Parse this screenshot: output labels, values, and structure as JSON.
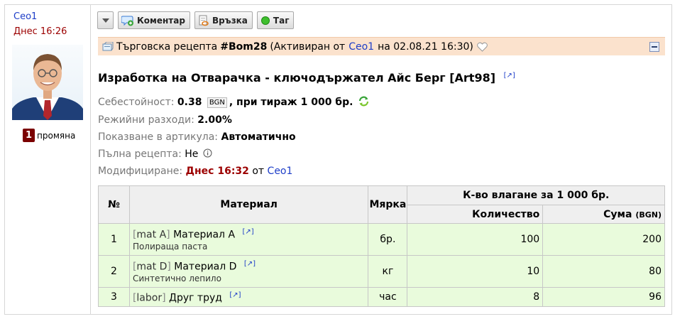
{
  "author": {
    "name": "Ceo1",
    "date": "Днес 16:26",
    "changes_count": "1",
    "changes_label": "промяна"
  },
  "toolbar": {
    "comment_label": "Коментар",
    "link_label": "Връзка",
    "tag_label": "Таг"
  },
  "banner": {
    "type_label": "Търговска рецепта",
    "number": "#Bom28",
    "status_prefix": "(Активиран от",
    "user": "Ceo1",
    "date_text": "на 02.08.21 16:30)"
  },
  "title": "Изработка на Отварачка - ключодържател Айс Берг [Art98]",
  "ext_link": "[↗]",
  "props": {
    "cost_label": "Себестойност:",
    "cost_value": "0.38",
    "currency": "BGN",
    "cost_suffix": ", при тираж 1 000 бр.",
    "overhead_label": "Режийни разходи:",
    "overhead_value": "2.00%",
    "show_label": "Показване в артикула:",
    "show_value": "Автоматично",
    "full_label": "Пълна рецепта:",
    "full_value": "Не",
    "modified_label": "Модифициране:",
    "modified_value": "Днес 16:32",
    "modified_by": "от",
    "modified_user": "Ceo1"
  },
  "table": {
    "h_num": "№",
    "h_material": "Материал",
    "h_unit": "Мярка",
    "h_group": "К-во влагане за 1 000 бр.",
    "h_qty": "Количество",
    "h_sum": "Сума",
    "h_sum_unit": "(BGN)",
    "rows": [
      {
        "num": "1",
        "code": "mat A",
        "name": "Материал А",
        "ext": "[↗]",
        "sub": "Полираща паста",
        "unit": "бр.",
        "qty": "100",
        "sum": "200"
      },
      {
        "num": "2",
        "code": "mat D",
        "name": "Материал D",
        "ext": "[↗]",
        "sub": "Синтетично лепило",
        "unit": "кг",
        "qty": "10",
        "sum": "80"
      },
      {
        "num": "3",
        "code": "labor",
        "name": "Друг труд",
        "ext": "[↗]",
        "sub": "",
        "unit": "час",
        "qty": "8",
        "sum": "96"
      }
    ]
  },
  "colors": {
    "link": "#1e3ec8",
    "date_red": "#9c0000",
    "banner_bg": "#fbe2cd",
    "row_bg": "#e9fbdc"
  },
  "icons": [
    "chevron-down-icon",
    "comment-add-icon",
    "link-icon",
    "tag-dot-icon",
    "recipe-icon",
    "heart-icon",
    "collapse-icon",
    "refresh-icon",
    "info-icon"
  ]
}
